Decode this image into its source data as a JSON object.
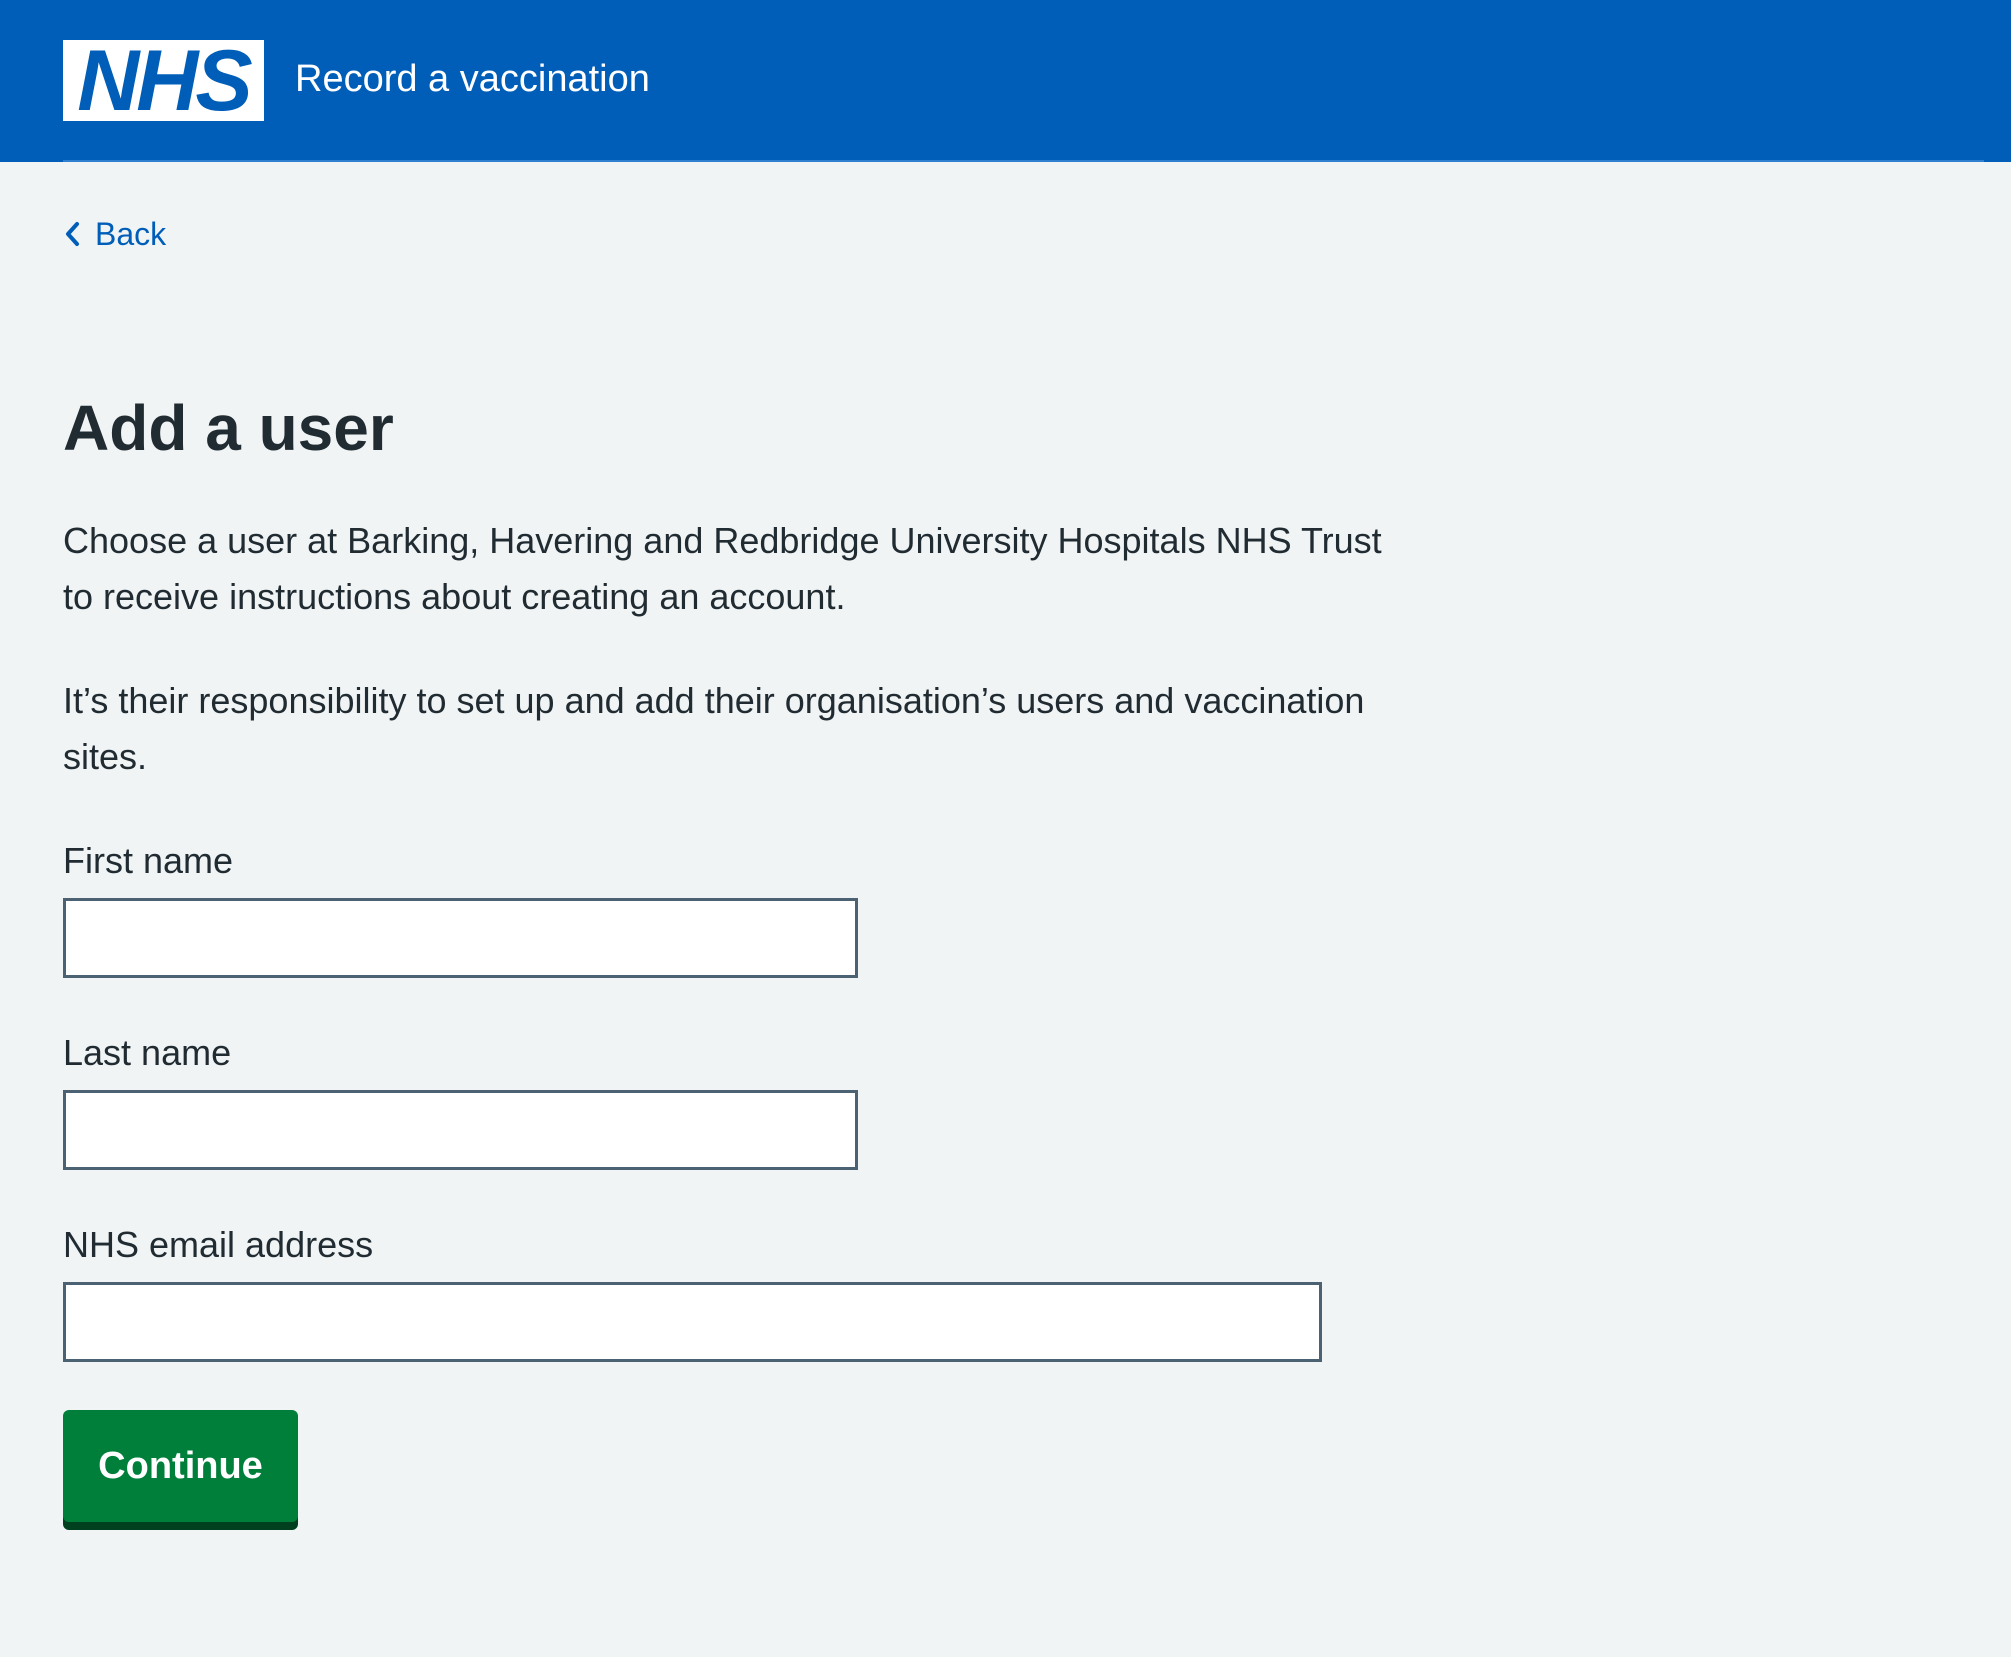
{
  "header": {
    "logo_text": "NHS",
    "service_name": "Record a vaccination"
  },
  "nav": {
    "back_label": "Back"
  },
  "page": {
    "title": "Add a user",
    "paragraph_1": "Choose a user at Barking, Havering and Redbridge University Hospitals NHS Trust to receive instructions about creating an account.",
    "paragraph_2": "It’s their responsibility to set up and add their organisation’s users and vaccination sites."
  },
  "form": {
    "first_name_label": "First name",
    "first_name_value": "",
    "last_name_label": "Last name",
    "last_name_value": "",
    "email_label": "NHS email address",
    "email_value": "",
    "continue_label": "Continue"
  },
  "colors": {
    "header_blue": "#005eb8",
    "background": "#f0f4f5",
    "button_green": "#007f3b",
    "text": "#212b32",
    "input_border": "#4c6272"
  }
}
